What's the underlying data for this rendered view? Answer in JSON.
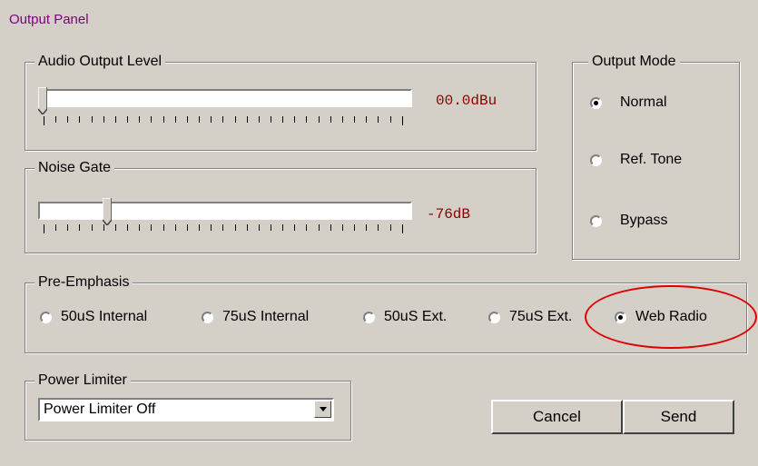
{
  "panel": {
    "title": "Output Panel"
  },
  "audio_output": {
    "label": "Audio Output Level",
    "readout": "00.0dBu",
    "level": 0.0
  },
  "noise_gate": {
    "label": "Noise Gate",
    "readout": "-76dB",
    "level": 0.18
  },
  "output_mode": {
    "label": "Output Mode",
    "options": [
      {
        "label": "Normal",
        "selected": true
      },
      {
        "label": "Ref. Tone",
        "selected": false
      },
      {
        "label": "Bypass",
        "selected": false
      }
    ]
  },
  "pre_emphasis": {
    "label": "Pre-Emphasis",
    "options": [
      {
        "label": "50uS Internal",
        "selected": false
      },
      {
        "label": "75uS Internal",
        "selected": false
      },
      {
        "label": "50uS Ext.",
        "selected": false
      },
      {
        "label": "75uS Ext.",
        "selected": false
      },
      {
        "label": "Web Radio",
        "selected": true
      }
    ]
  },
  "power_limiter": {
    "label": "Power Limiter",
    "selected": "Power Limiter Off"
  },
  "buttons": {
    "cancel": "Cancel",
    "send": "Send"
  },
  "colors": {
    "background": "#d4d0c8",
    "title": "#800080",
    "readout": "#8b0000",
    "highlight": "#e00000"
  }
}
